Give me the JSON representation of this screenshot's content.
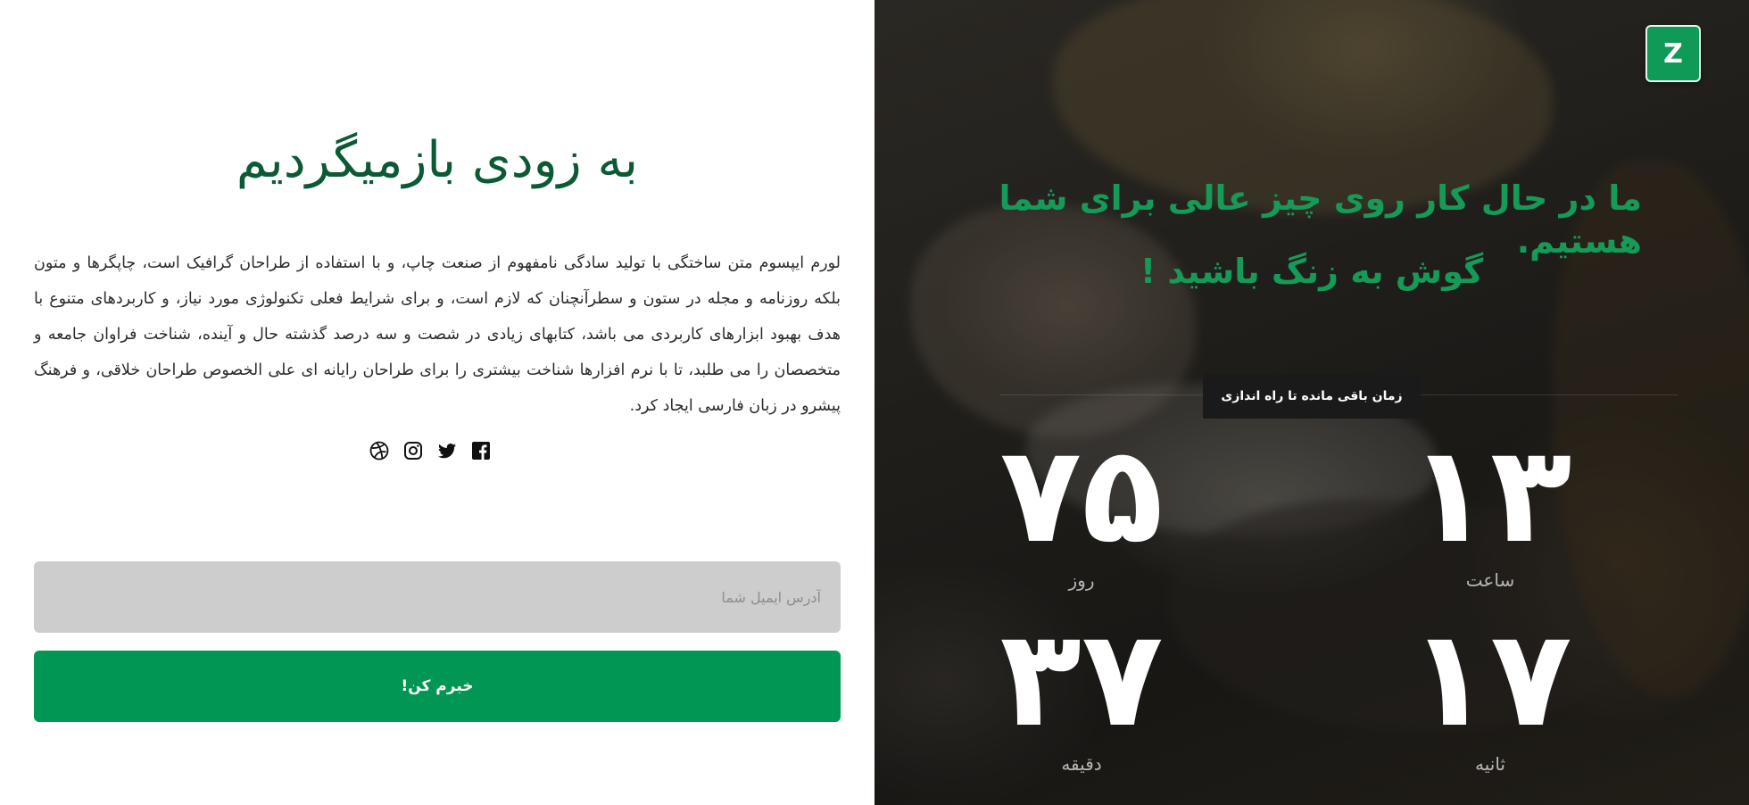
{
  "left": {
    "title": "به زودی بازمیگردیم",
    "paragraph": "لورم ایپسوم متن ساختگی با تولید سادگی نامفهوم از صنعت چاپ، و با استفاده از طراحان گرافیک است، چاپگرها و متون بلکه روزنامه و مجله در ستون و سطرآنچنان که لازم است، و برای شرایط فعلی تکنولوژی مورد نیاز، و کاربردهای متنوع با هدف بهبود ابزارهای کاربردی می باشد، کتابهای زیادی در شصت و سه درصد گذشته حال و آینده، شناخت فراوان جامعه و متخصصان را می طلبد، تا با نرم افزارها شناخت بیشتری را برای طراحان رایانه ای علی الخصوص طراحان خلاقی، و فرهنگ پیشرو در زبان فارسی ایجاد کرد.",
    "social": [
      {
        "name": "facebook-icon"
      },
      {
        "name": "twitter-icon"
      },
      {
        "name": "instagram-icon"
      },
      {
        "name": "dribbble-icon"
      }
    ],
    "email_placeholder": "آدرس ایمیل شما",
    "notify_label": "خبرم کن!"
  },
  "right": {
    "logo_letter": "Z",
    "headline_1": "ما در حال کار روی چیز عالی برای شما هستیم.",
    "headline_2": "گوش به زنگ باشید !",
    "countdown_label": "زمان باقی مانده تا راه اندازی",
    "countdown": {
      "hours": {
        "value": "۱۳",
        "unit": "ساعت"
      },
      "days": {
        "value": "۷۵",
        "unit": "روز"
      },
      "seconds": {
        "value": "۱۷",
        "unit": "ثانیه"
      },
      "minutes": {
        "value": "۳۷",
        "unit": "دقیقه"
      }
    }
  },
  "colors": {
    "accent": "#029654",
    "title_green": "#0c5a35",
    "headline_green": "#169a57",
    "input_bg": "#cdcdcd"
  }
}
